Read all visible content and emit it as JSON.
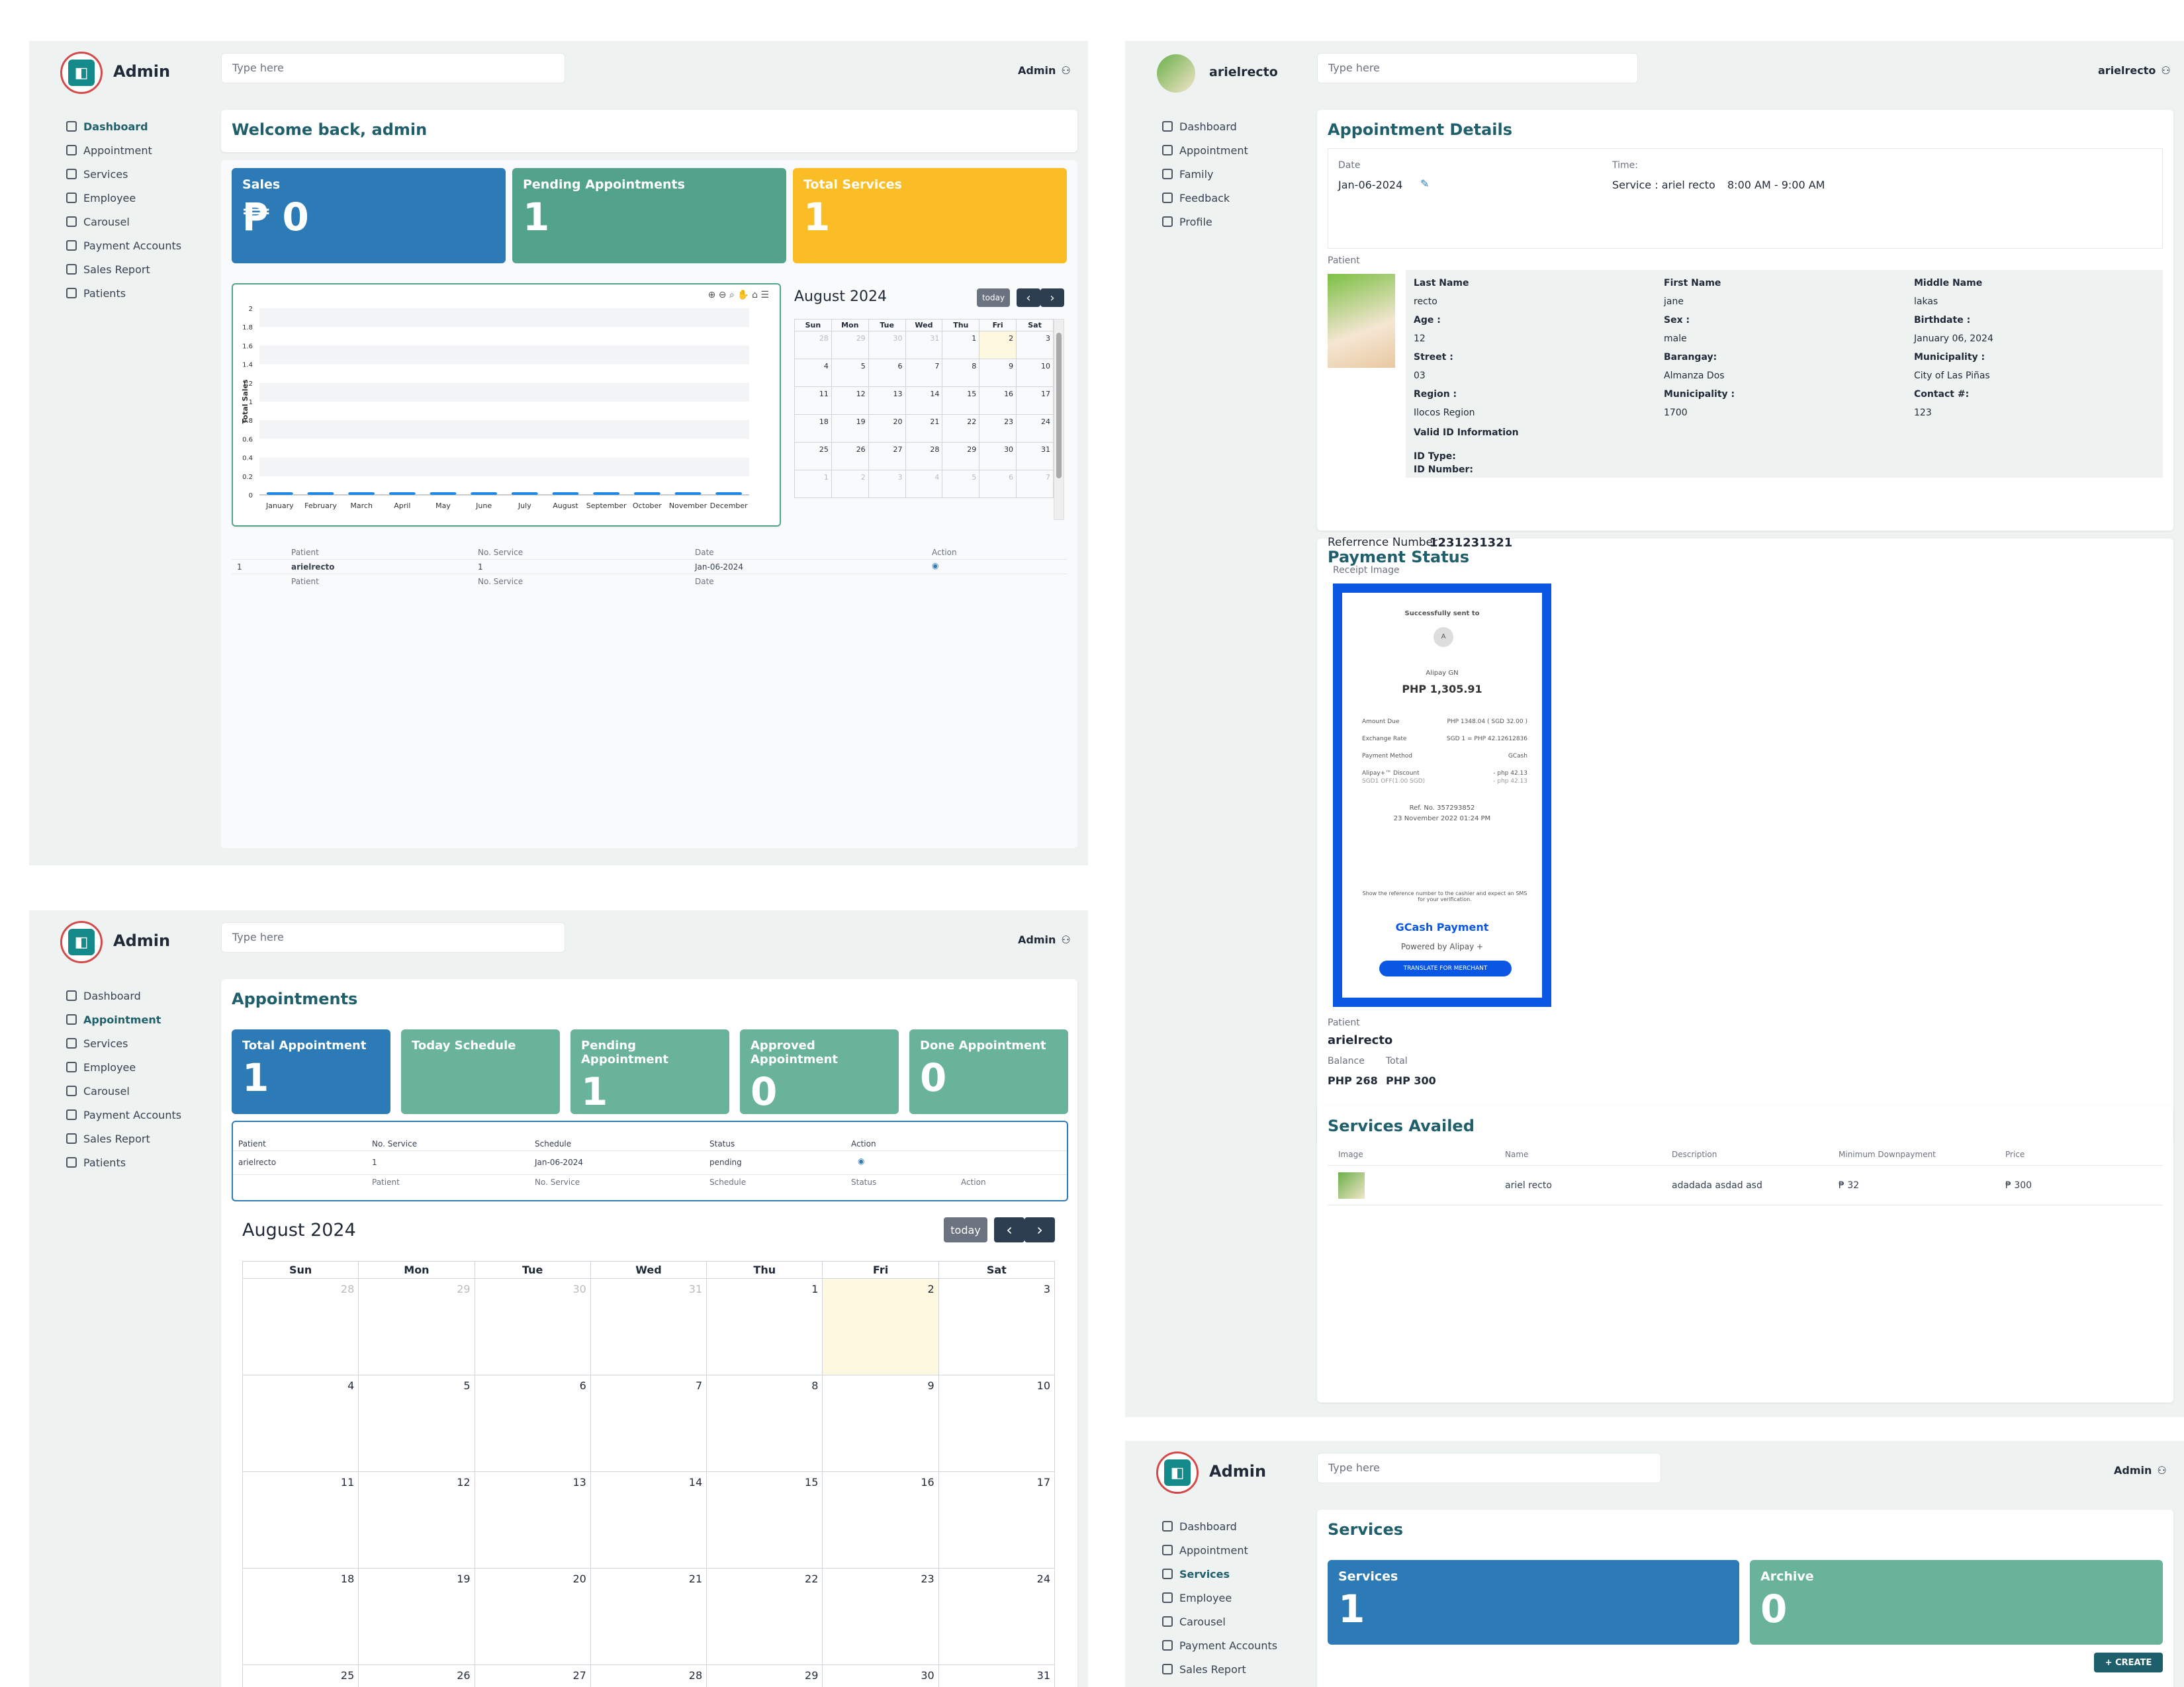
{
  "colors": {
    "blue": "#2c7bb6",
    "green": "#53a38b",
    "yellow": "#fbbd25",
    "teal": "#69b39b",
    "darkteal": "#1f5f6b"
  },
  "common": {
    "search_placeholder": "Type here",
    "admin_label": "Admin",
    "brand": "Admin",
    "nav": [
      "Dashboard",
      "Appointment",
      "Services",
      "Employee",
      "Carousel",
      "Payment Accounts",
      "Sales Report",
      "Patients"
    ],
    "nav_icons": [
      "grid-icon",
      "edit-icon",
      "list-icon",
      "tools-icon",
      "carousel-icon",
      "wallet-icon",
      "chart-icon",
      "patients-icon"
    ]
  },
  "dashboard": {
    "welcome": "Welcome back, admin",
    "stats": [
      {
        "label": "Sales",
        "value": "₱ 0"
      },
      {
        "label": "Pending Appointments",
        "value": "1"
      },
      {
        "label": "Total Services",
        "value": "1"
      }
    ],
    "table": {
      "headers": [
        "Patient",
        "No. Service",
        "Date",
        "Action"
      ],
      "rows": [
        [
          "1",
          "arielrecto",
          "1",
          "Jan-06-2024"
        ]
      ],
      "footer": [
        "Patient",
        "No. Service",
        "Date"
      ]
    }
  },
  "chart_data": {
    "type": "bar",
    "categories": [
      "January",
      "February",
      "March",
      "April",
      "May",
      "June",
      "July",
      "August",
      "September",
      "October",
      "November",
      "December"
    ],
    "values": [
      0,
      0,
      0,
      0,
      0,
      0,
      0,
      0,
      0,
      0,
      0,
      0
    ],
    "ylabel": "Total Sales",
    "ylim": [
      0,
      2
    ],
    "yticks": [
      "2",
      "1.8",
      "1.6",
      "1.4",
      "1.2",
      "1",
      "0.8",
      "0.6",
      "0.4",
      "0.2",
      "0"
    ]
  },
  "calendar": {
    "title": "August 2024",
    "today": "today",
    "days": [
      "Sun",
      "Mon",
      "Tue",
      "Wed",
      "Thu",
      "Fri",
      "Sat"
    ],
    "weeks": [
      [
        "28",
        "29",
        "30",
        "31",
        "1",
        "2",
        "3"
      ],
      [
        "4",
        "5",
        "6",
        "7",
        "8",
        "9",
        "10"
      ],
      [
        "11",
        "12",
        "13",
        "14",
        "15",
        "16",
        "17"
      ],
      [
        "18",
        "19",
        "20",
        "21",
        "22",
        "23",
        "24"
      ],
      [
        "25",
        "26",
        "27",
        "28",
        "29",
        "30",
        "31"
      ],
      [
        "1",
        "2",
        "3",
        "4",
        "5",
        "6",
        "7"
      ]
    ]
  },
  "appointments": {
    "title": "Appointments",
    "stats": [
      {
        "label": "Total Appointment",
        "value": "1"
      },
      {
        "label": "Today Schedule",
        "value": ""
      },
      {
        "label": "Pending Appointment",
        "value": "1"
      },
      {
        "label": "Approved Appointment",
        "value": "0"
      },
      {
        "label": "Done Appointment",
        "value": "0"
      }
    ],
    "table": {
      "headers": [
        "Patient",
        "No. Service",
        "Schedule",
        "Status",
        "Action"
      ],
      "row": [
        "arielrecto",
        "1",
        "Jan-06-2024",
        "pending"
      ],
      "footer": [
        "Patient",
        "No. Service",
        "Schedule",
        "Status",
        "Action"
      ]
    }
  },
  "details": {
    "user": "arielrecto",
    "nav": [
      "Dashboard",
      "Appointment",
      "Family",
      "Feedback",
      "Profile"
    ],
    "title": "Appointment Details",
    "date_label": "Date",
    "date": "Jan-06-2024",
    "time_label": "Time:",
    "service": "Service : ariel recto",
    "time": "8:00 AM - 9:00 AM",
    "patient_label": "Patient",
    "fields": [
      [
        "Last Name",
        "First Name",
        "Middle Name"
      ],
      [
        "recto",
        "jane",
        "lakas"
      ],
      [
        "Age :",
        "Sex :",
        "Birthdate :"
      ],
      [
        "12",
        "male",
        "January 06, 2024"
      ],
      [
        "Street :",
        "Barangay:",
        "Municipality :"
      ],
      [
        "03",
        "Almanza Dos",
        "City of Las Piñas"
      ],
      [
        "Region :",
        "Municipality :",
        "Contact #:"
      ],
      [
        "Ilocos Region",
        "1700",
        "123"
      ]
    ],
    "valid_id": "Valid ID Information",
    "id_type": "ID Type:",
    "id_number": "ID Number:",
    "payment_title": "Payment Status",
    "ref_label": "Referrence Number :",
    "ref": "1231231321",
    "receipt_label": "Receipt Image",
    "receipt": {
      "sent": "Successfully sent to",
      "avatar": "A",
      "name": "Alipay GN",
      "amount": "PHP 1,305.91",
      "lines": [
        [
          "Amount Due",
          "PHP 1348.04 ( SGD 32.00 )"
        ],
        [
          "Exchange Rate",
          "SGD 1 = PHP 42.12612836"
        ],
        [
          "Payment Method",
          "GCash"
        ],
        [
          "Alipay+™ Discount",
          "- php 42.13"
        ],
        [
          "SGD1 OFF(1.00 SGD)",
          "- php 42.13"
        ]
      ],
      "refno": "Ref. No. 357293852",
      "date": "23 November 2022 01:24 PM",
      "note": "Show the reference number to the cashier and expect an SMS for your verification.",
      "gcash": "GCash Payment",
      "powered": "Powered by Alipay +",
      "translate": "TRANSLATE FOR MERCHANT"
    },
    "patient_name": "arielrecto",
    "balance_label": "Balance",
    "total_label": "Total",
    "balance": "PHP 268",
    "total": "PHP 300",
    "services_title": "Services Availed",
    "services_headers": [
      "Image",
      "Name",
      "Description",
      "Minimum Downpayment",
      "Price"
    ],
    "services_row": [
      "ariel recto",
      "adadada asdad asd",
      "₱ 32",
      "₱ 300"
    ]
  },
  "services_page": {
    "title": "Services",
    "stats": [
      {
        "label": "Services",
        "value": "1"
      },
      {
        "label": "Archive",
        "value": "0"
      }
    ],
    "create": "+ CREATE"
  }
}
